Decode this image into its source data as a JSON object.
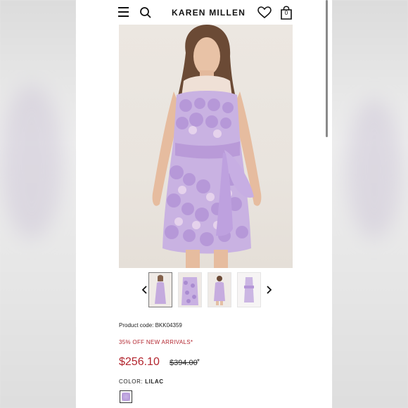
{
  "header": {
    "brand": "KAREN MILLEN",
    "bag_count": "0"
  },
  "gallery": {
    "thumbnails": [
      "front-view",
      "detail-view",
      "back-view",
      "flat-view"
    ],
    "active_index": 0
  },
  "product": {
    "code_label": "Product code: BKK04359",
    "promo": "35% OFF NEW ARRIVALS*",
    "price_now": "$256.10",
    "price_was": "$394.00",
    "price_mark": "*",
    "color_label": "COLOR:",
    "color_value": "LILAC"
  },
  "colors": {
    "accent_red": "#b3262f",
    "lilac": "#b79bd9"
  }
}
